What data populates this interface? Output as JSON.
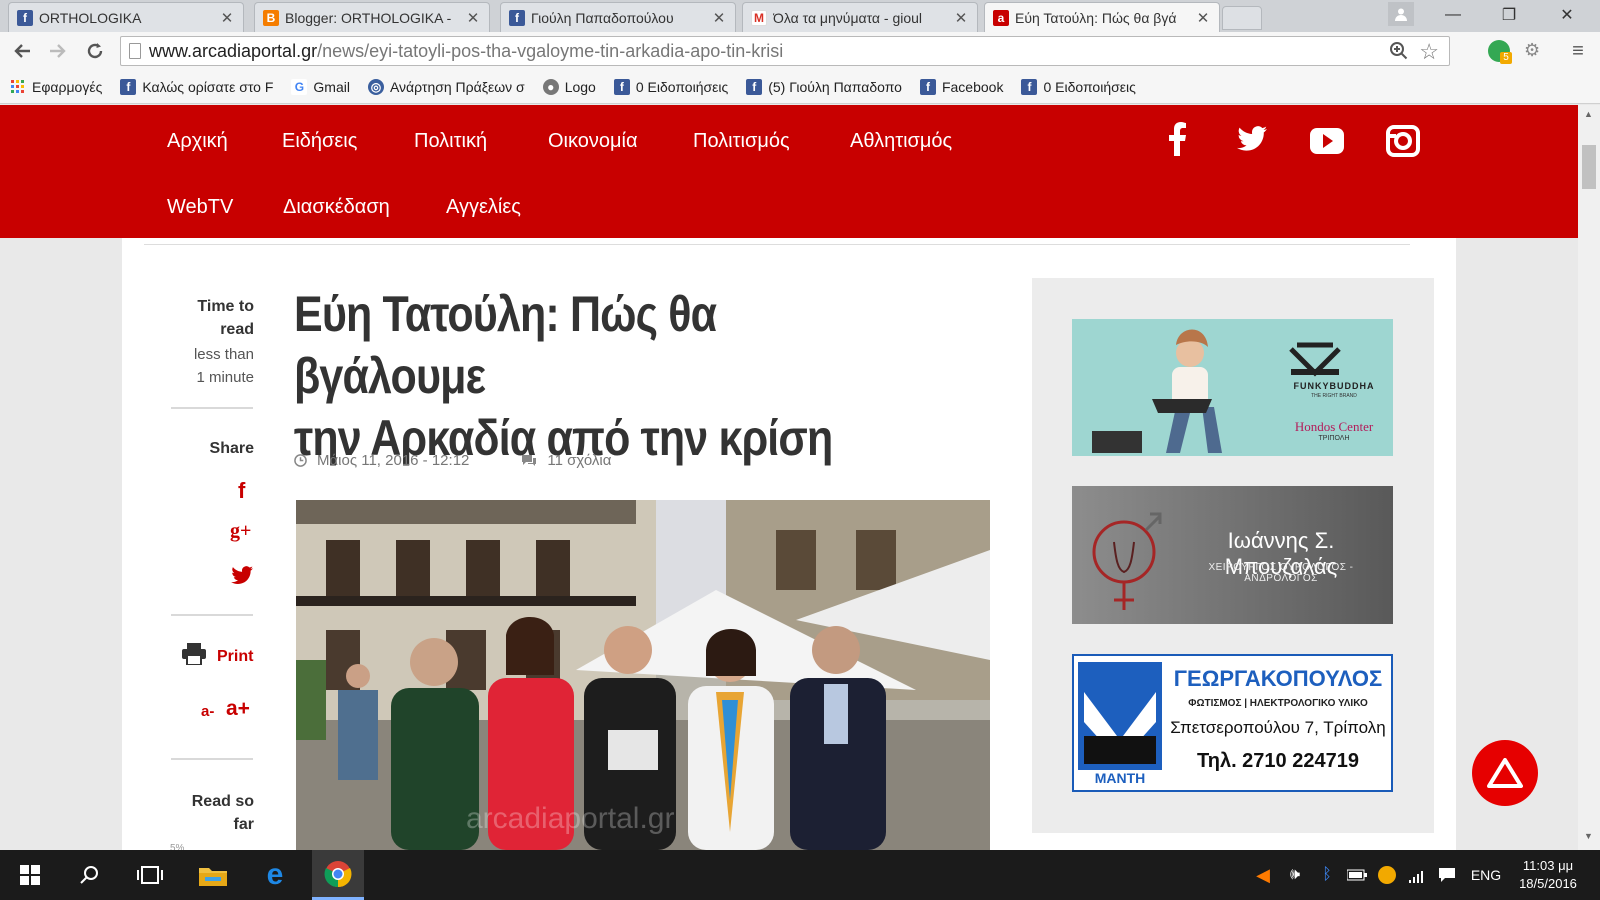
{
  "browser": {
    "tabs": [
      {
        "title": "ORTHOLOGIKA",
        "icon": "facebook-icon",
        "color": "#3b5998"
      },
      {
        "title": "Blogger: ORTHOLOGIKA -",
        "icon": "blogger-icon",
        "color": "#f57d00"
      },
      {
        "title": "Γιούλη Παπαδοπούλου",
        "icon": "facebook-icon",
        "color": "#3b5998"
      },
      {
        "title": "Όλα τα μηνύματα - gioul",
        "icon": "gmail-icon",
        "color": "#d93025"
      },
      {
        "title": "Εύη Τατούλη: Πώς θα βγά",
        "icon": "arcadia-icon",
        "color": "#c80000"
      }
    ],
    "url_host": "www.arcadiaportal.gr",
    "url_path": "/news/eyi-tatoyli-pos-tha-vgaloyme-tin-arkadia-apo-tin-krisi",
    "bookmarks": [
      {
        "label": "Εφαρμογές",
        "icon": "apps-icon",
        "color": "#4285f4"
      },
      {
        "label": "Καλώς ορίσατε στο F",
        "icon": "facebook-icon",
        "color": "#3b5998"
      },
      {
        "label": "Gmail",
        "icon": "google-icon",
        "color": "#4285f4"
      },
      {
        "label": "Ανάρτηση Πράξεων σ",
        "icon": "globe-icon",
        "color": "#3a5f9e"
      },
      {
        "label": "Logo",
        "icon": "logo-icon",
        "color": "#777777"
      },
      {
        "label": "0 Ειδοποιήσεις",
        "icon": "facebook-icon",
        "color": "#3b5998"
      },
      {
        "label": "(5) Γιούλη Παπαδοπο",
        "icon": "facebook-icon",
        "color": "#3b5998"
      },
      {
        "label": "Facebook",
        "icon": "facebook-icon",
        "color": "#3b5998"
      },
      {
        "label": "0 Ειδοποιήσεις",
        "icon": "facebook-icon",
        "color": "#3b5998"
      }
    ],
    "extension_badge": "5"
  },
  "site": {
    "nav": [
      "Αρχική",
      "Ειδήσεις",
      "Πολιτική",
      "Οικονομία",
      "Πολιτισμός",
      "Αθλητισμός",
      "WebTV",
      "Διασκέδαση",
      "Αγγελίες"
    ],
    "social_icons": [
      "facebook-icon",
      "twitter-icon",
      "youtube-icon",
      "instagram-icon"
    ],
    "brand_color": "#c80000"
  },
  "sidebar": {
    "time_label_1": "Time to",
    "time_label_2": "read",
    "time_value_1": "less than",
    "time_value_2": "1 minute",
    "share_label": "Share",
    "print_label": "Print",
    "font_minus": "a-",
    "font_plus": "a+",
    "read_label_1": "Read so",
    "read_label_2": "far",
    "read_percent": "5%"
  },
  "article": {
    "title_line1": "Εύη Τατούλη: Πώς θα βγάλουμε",
    "title_line2": "την Αρκαδία από την κρίση",
    "date": "Μάιος 11, 2016 - 12:12",
    "comments": "11 σχόλια",
    "photo_watermark": "arcadiaportal.gr"
  },
  "ads": [
    {
      "brand": "FUNKYBUDDHA",
      "sub": "THE RIGHT BRAND",
      "place": "Hondos Center",
      "city": "ΤΡΙΠΟΛΗ"
    },
    {
      "name": "Ιωάννης Σ. Μπουζαλάς",
      "role": "ΧΕΙΡΟΥΡΓΟΣ ΟΥΡΟΛΟΓΟΣ - ΑΝΔΡΟΛΟΓΟΣ"
    },
    {
      "name": "ΓΕΩΡΓΑΚΟΠΟΥΛΟΣ",
      "role": "ΦΩΤΙΣΜΟΣ | ΗΛΕΚΤΡΟΛΟΓΙΚΟ ΥΛΙΚΟ",
      "address": "Σπετσεροπούλου 7, Τρίπολη",
      "phone": "Τηλ. 2710 224719",
      "logo": "MANTH"
    }
  ],
  "taskbar": {
    "time": "11:03 μμ",
    "date": "18/5/2016",
    "lang": "ENG"
  }
}
